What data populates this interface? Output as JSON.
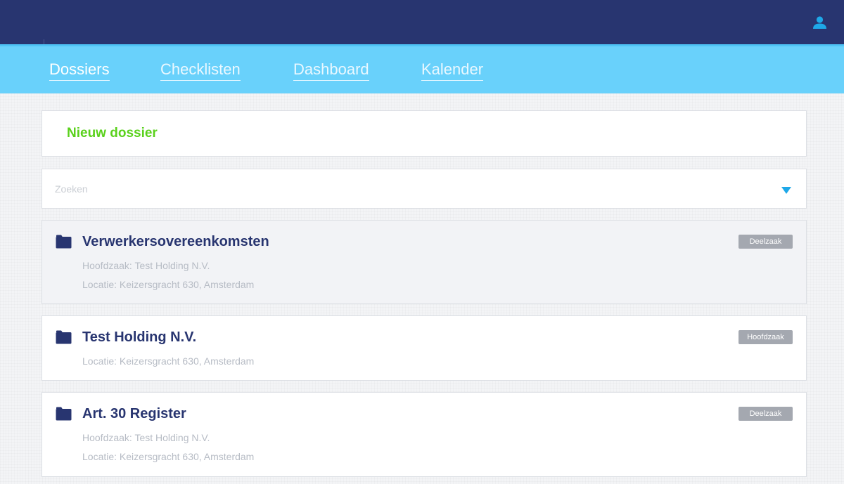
{
  "header": {
    "user_icon": "user-icon",
    "colors": {
      "topbar": "#283570",
      "navbar": "#69d1fb",
      "accent": "#1ea8e8"
    }
  },
  "nav": {
    "items": [
      {
        "label": "Dossiers",
        "active": true
      },
      {
        "label": "Checklisten",
        "active": false
      },
      {
        "label": "Dashboard",
        "active": false
      },
      {
        "label": "Kalender",
        "active": false
      }
    ]
  },
  "actions": {
    "new_dossier_label": "Nieuw dossier",
    "new_dossier_color": "#5ad11c"
  },
  "search": {
    "placeholder": "Zoeken",
    "value": ""
  },
  "dossiers": [
    {
      "title": "Verwerkersovereenkomsten",
      "hoofdzaak": "Hoofdzaak: Test Holding N.V.",
      "locatie": "Locatie: Keizersgracht 630, Amsterdam",
      "badge": "Deelzaak",
      "icon": "folder-icon"
    },
    {
      "title": "Test Holding N.V.",
      "locatie": "Locatie: Keizersgracht 630, Amsterdam",
      "badge": "Hoofdzaak",
      "icon": "folder-icon"
    },
    {
      "title": "Art. 30 Register",
      "hoofdzaak": "Hoofdzaak: Test Holding N.V.",
      "locatie": "Locatie: Keizersgracht 630, Amsterdam",
      "badge": "Deelzaak",
      "icon": "folder-icon"
    }
  ]
}
